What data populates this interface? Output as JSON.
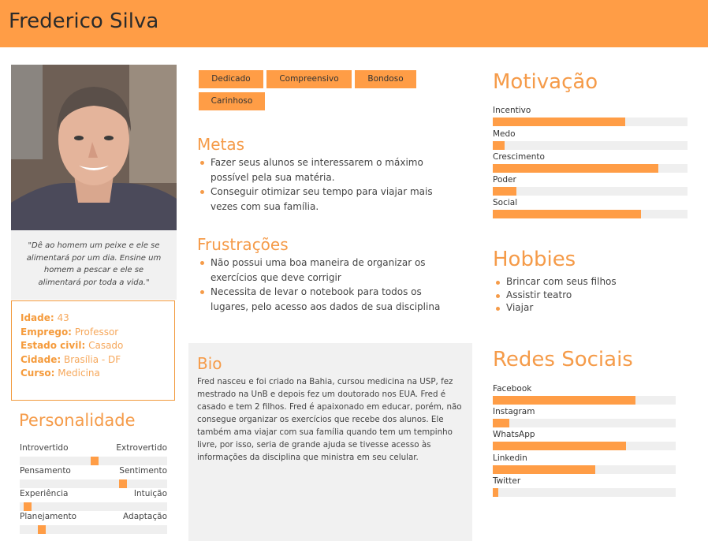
{
  "persona": {
    "name": "Frederico Silva",
    "quote": "\"Dê ao homem um peixe e ele se alimentará por um dia. Ensine um homem a pescar e ele se alimentará por toda a vida.\""
  },
  "info": [
    {
      "label": "Idade:",
      "value": "43"
    },
    {
      "label": "Emprego:",
      "value": "Professor"
    },
    {
      "label": "Estado civil:",
      "value": "Casado"
    },
    {
      "label": "Cidade:",
      "value": "Brasília - DF"
    },
    {
      "label": "Curso:",
      "value": "Medicina"
    }
  ],
  "personality": {
    "title": "Personalidade",
    "traits": [
      {
        "left": "Introvertido",
        "right": "Extrovertido",
        "level": 0.51
      },
      {
        "left": "Pensamento",
        "right": "Sentimento",
        "level": 0.71
      },
      {
        "left": "Experiência",
        "right": "Intuição",
        "level": 0.03
      },
      {
        "left": "Planejamento",
        "right": "Adaptação",
        "level": 0.13
      }
    ]
  },
  "tags": [
    "Dedicado",
    "Compreensivo",
    "Bondoso",
    "Carinhoso"
  ],
  "goals": {
    "title": "Metas",
    "items": [
      "Fazer seus alunos se interessarem o máximo possível pela sua matéria.",
      "Conseguir otimizar seu tempo para viajar mais vezes com sua família."
    ]
  },
  "frustrations": {
    "title": "Frustrações",
    "items": [
      "Não possui uma boa maneira de organizar os exercícios que deve corrigir",
      "Necessita de levar o notebook para todos os lugares, pelo acesso aos dados de sua disciplina"
    ]
  },
  "bio": {
    "title": "Bio",
    "text": "Fred nasceu e foi criado na Bahia, cursou medicina na USP, fez mestrado na UnB e depois fez um doutorado nos EUA. Fred é casado e tem 2 filhos. Fred é apaixonado em educar, porém, não consegue organizar os exercícios que recebe dos alunos. Ele também ama viajar com sua família quando tem um tempinho livre, por isso, seria de grande ajuda se tivesse acesso às informações da disciplina que ministra em seu celular."
  },
  "motivation": {
    "title": "Motivação",
    "items": [
      {
        "label": "Incentivo",
        "value": 0.68
      },
      {
        "label": "Medo",
        "value": 0.06
      },
      {
        "label": "Crescimento",
        "value": 0.85
      },
      {
        "label": "Poder",
        "value": 0.12
      },
      {
        "label": "Social",
        "value": 0.76
      }
    ]
  },
  "hobbies": {
    "title": "Hobbies",
    "items": [
      "Brincar com seus filhos",
      "Assistir teatro",
      "Viajar"
    ]
  },
  "social": {
    "title": "Redes Sociais",
    "items": [
      {
        "label": "Facebook",
        "value": 0.78
      },
      {
        "label": "Instagram",
        "value": 0.09
      },
      {
        "label": "WhatsApp",
        "value": 0.73
      },
      {
        "label": "Linkedin",
        "value": 0.56
      },
      {
        "label": "Twitter",
        "value": 0.03
      }
    ]
  },
  "colors": {
    "accent": "#ff9d46",
    "track": "#efefef",
    "panel": "#f1f1f1"
  }
}
